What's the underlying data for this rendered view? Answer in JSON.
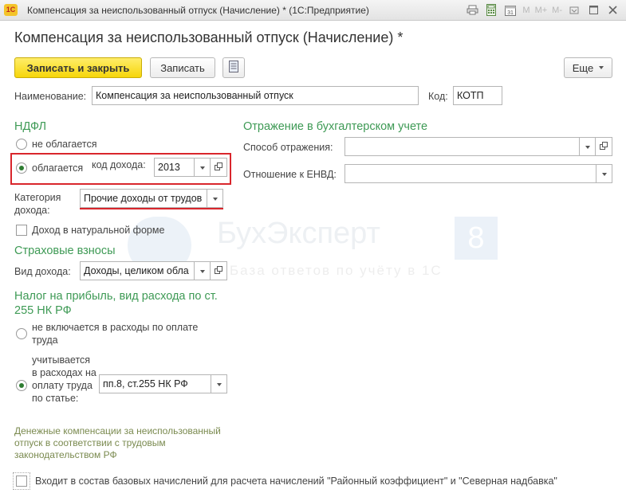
{
  "window": {
    "app_logo": "1С",
    "title": "Компенсация за неиспользованный отпуск (Начисление) * (1С:Предприятие)",
    "tools": {
      "m": "M",
      "m_plus": "M+",
      "m_minus": "M-"
    }
  },
  "form": {
    "title": "Компенсация за неиспользованный отпуск (Начисление) *",
    "toolbar": {
      "save_close": "Записать и закрыть",
      "save": "Записать",
      "more": "Еще"
    },
    "name_label": "Наименование:",
    "name_value": "Компенсация за неиспользованный отпуск",
    "code_label": "Код:",
    "code_value": "КОТП"
  },
  "ndfl": {
    "section": "НДФЛ",
    "not_taxed": "не облагается",
    "taxed": "облагается",
    "income_code_label": "код дохода:",
    "income_code_value": "2013",
    "category_label": "Категория дохода:",
    "category_value": "Прочие доходы от трудов",
    "natural_form": "Доход в натуральной форме"
  },
  "insurance": {
    "section": "Страховые взносы",
    "income_kind_label": "Вид дохода:",
    "income_kind_value": "Доходы, целиком обла"
  },
  "profit_tax": {
    "section": "Налог на прибыль, вид расхода по ст. 255 НК РФ",
    "not_included": "не включается в расходы по оплате труда",
    "included": "учитывается в расходах на оплату труда по статье:",
    "article_value": "пп.8, ст.255 НК РФ",
    "note": "Денежные компенсации за неиспользованный отпуск в соответствии с трудовым законодательством РФ"
  },
  "accounting": {
    "section": "Отражение в бухгалтерском учете",
    "method_label": "Способ отражения:",
    "method_value": "",
    "envd_label": "Отношение к ЕНВД:",
    "envd_value": ""
  },
  "bottom": {
    "base_accruals": "Входит в состав базовых начислений для расчета начислений \"Районный коэффициент\" и \"Северная надбавка\""
  },
  "watermark": {
    "brand": "БухЭксперт",
    "digit": "8",
    "tagline": "База ответов по учёту в 1С"
  },
  "colors": {
    "section_green": "#3e9a55",
    "highlight_red": "#d9262c",
    "primary_yellow": "#f6d60a"
  }
}
